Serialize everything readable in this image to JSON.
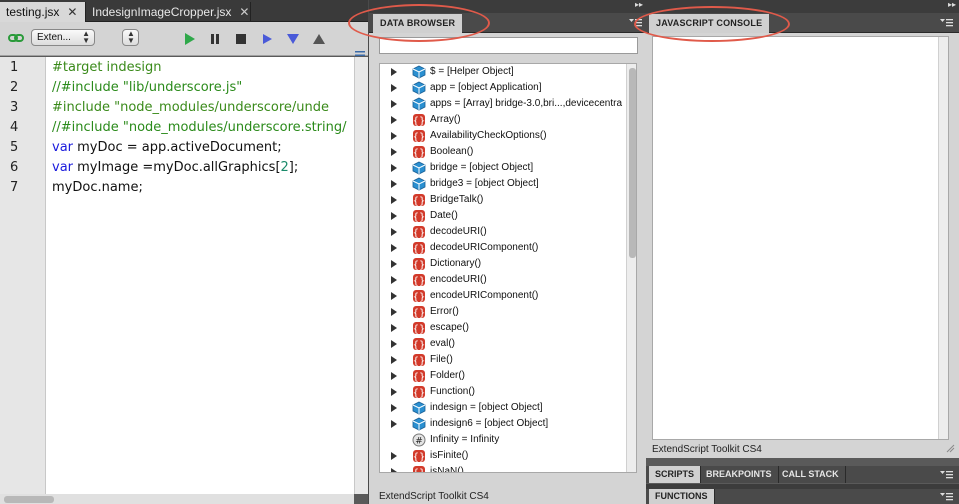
{
  "editor": {
    "tabs": [
      {
        "label": "testing.jsx",
        "close": "✕",
        "active": true
      },
      {
        "label": "IndesignImageCropper.jsx",
        "close": "✕",
        "active": false
      }
    ],
    "toolbar": {
      "target_value": "Exten...",
      "engine_value": ""
    },
    "line_numbers": [
      "1",
      "2",
      "3",
      "4",
      "5",
      "6",
      "7"
    ],
    "code": {
      "line1": "#target indesign",
      "line2": "//#include \"lib/underscore.js\"",
      "line3": "#include \"node_modules/underscore/unde",
      "line4": "//#include \"node_modules/underscore.string/",
      "line5_kw": "var",
      "line5_rest": " myDoc = app.activeDocument;",
      "line6_kw": "var",
      "line6_a": " myImage =myDoc.allGraphics[",
      "line6_num": "2",
      "line6_b": "];",
      "line7": "myDoc.name;"
    }
  },
  "data_browser": {
    "tab_label": "DATA BROWSER",
    "search_value": "",
    "footer": "ExtendScript Toolkit CS4",
    "items": [
      {
        "icon": "object",
        "label": "$ = [Helper Object]"
      },
      {
        "icon": "object",
        "label": "app = [object Application]"
      },
      {
        "icon": "object",
        "label": "apps = [Array] bridge-3.0,bri...,devicecentra"
      },
      {
        "icon": "function",
        "label": "Array()"
      },
      {
        "icon": "function",
        "label": "AvailabilityCheckOptions()"
      },
      {
        "icon": "function",
        "label": "Boolean()"
      },
      {
        "icon": "object",
        "label": "bridge = [object Object]"
      },
      {
        "icon": "object",
        "label": "bridge3 = [object Object]"
      },
      {
        "icon": "function",
        "label": "BridgeTalk()"
      },
      {
        "icon": "function",
        "label": "Date()"
      },
      {
        "icon": "function",
        "label": "decodeURI()"
      },
      {
        "icon": "function",
        "label": "decodeURIComponent()"
      },
      {
        "icon": "function",
        "label": "Dictionary()"
      },
      {
        "icon": "function",
        "label": "encodeURI()"
      },
      {
        "icon": "function",
        "label": "encodeURIComponent()"
      },
      {
        "icon": "function",
        "label": "Error()"
      },
      {
        "icon": "function",
        "label": "escape()"
      },
      {
        "icon": "function",
        "label": "eval()"
      },
      {
        "icon": "function",
        "label": "File()"
      },
      {
        "icon": "function",
        "label": "Folder()"
      },
      {
        "icon": "function",
        "label": "Function()"
      },
      {
        "icon": "object",
        "label": "indesign = [object Object]"
      },
      {
        "icon": "object",
        "label": "indesign6 = [object Object]"
      },
      {
        "icon": "number",
        "label": "Infinity = Infinity"
      },
      {
        "icon": "function",
        "label": "isFinite()"
      },
      {
        "icon": "function",
        "label": "isNaN()"
      }
    ],
    "no_expand": [
      "Infinity = Infinity"
    ]
  },
  "js_console": {
    "tab_label": "JAVASCRIPT CONSOLE",
    "footer": "ExtendScript Toolkit CS4"
  },
  "bottom_panels": {
    "tabs": [
      {
        "label": "SCRIPTS",
        "active": true
      },
      {
        "label": "BREAKPOINTS",
        "active": false
      },
      {
        "label": "CALL STACK",
        "active": false
      }
    ],
    "functions_label": "FUNCTIONS"
  },
  "colors": {
    "annotation": "#e05a4a",
    "keyword": "#1a1adc",
    "comment": "#2a8a1a",
    "function_icon": "#d23a2a",
    "object_icon": "#2a8fd0"
  }
}
